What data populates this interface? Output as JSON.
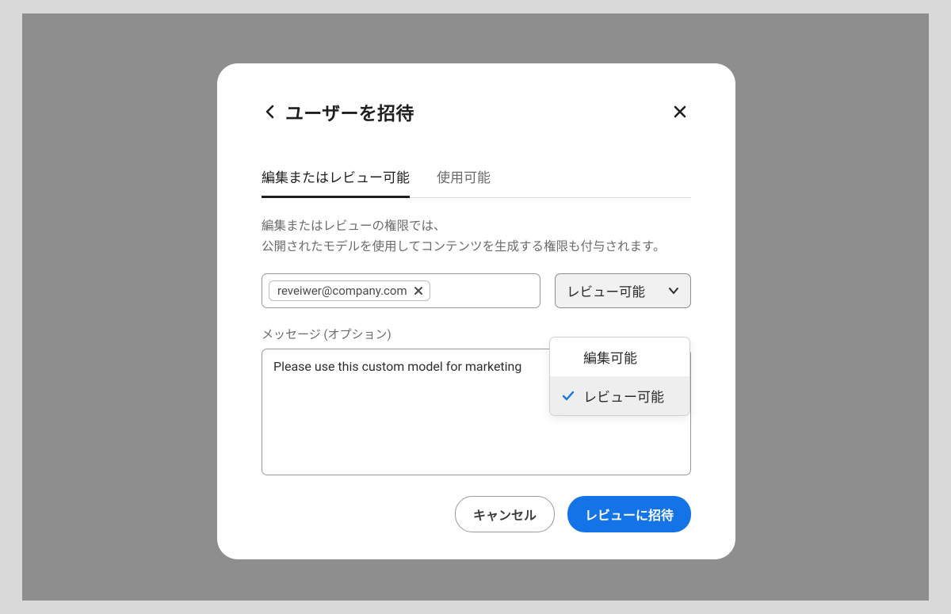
{
  "dialog": {
    "title": "ユーザーを招待",
    "tabs": [
      {
        "label": "編集またはレビュー可能",
        "active": true
      },
      {
        "label": "使用可能",
        "active": false
      }
    ],
    "description": "編集またはレビューの権限では、\n公開されたモデルを使用してコンテンツを生成する権限も付与されます。",
    "email_chips": [
      {
        "email": "reveiwer@company.com"
      }
    ],
    "permission": {
      "selected_label": "レビュー可能",
      "options": [
        {
          "label": "編集可能",
          "selected": false
        },
        {
          "label": "レビュー可能",
          "selected": true
        }
      ]
    },
    "message": {
      "label": "メッセージ (オプション)",
      "value": "Please use this custom model for marketing"
    },
    "buttons": {
      "cancel": "キャンセル",
      "invite": "レビューに招待"
    }
  }
}
